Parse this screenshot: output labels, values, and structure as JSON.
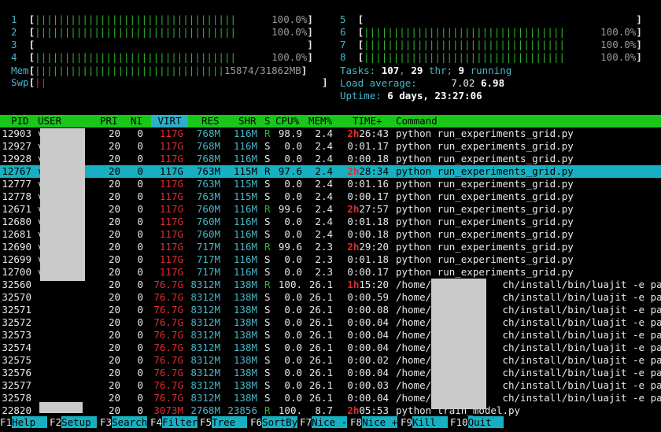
{
  "cpu_meters": [
    {
      "id": "1",
      "bar": "||||||||||||||||||||||||||||||||||",
      "value": "100.0%",
      "color": "g"
    },
    {
      "id": "2",
      "bar": "||||||||||||||||||||||||||||||||||",
      "value": "100.0%",
      "color": "g"
    },
    {
      "id": "3",
      "bar": "",
      "value": "",
      "color": "g"
    },
    {
      "id": "4",
      "bar": "||||||||||||||||||||||||||||||||||",
      "value": "100.0%",
      "color": "g"
    },
    {
      "id": "5",
      "bar": "",
      "value": "",
      "color": "g"
    },
    {
      "id": "6",
      "bar": "||||||||||||||||||||||||||||||||||",
      "value": "100.0%",
      "color": "g"
    },
    {
      "id": "7",
      "bar": "||||||||||||||||||||||||||||||||||",
      "value": "100.0%",
      "color": "g"
    },
    {
      "id": "8",
      "bar": "||||||||||||||||||||||||||||||||||",
      "value": "100.0%",
      "color": "g"
    }
  ],
  "mem": {
    "label": "Mem",
    "bar": "||||||||||||||||||||||||||||||||",
    "value": "15874/31862MB"
  },
  "swp": {
    "label": "Swp",
    "bar": "||",
    "value": ""
  },
  "tasks": {
    "label": "Tasks: ",
    "count": "107",
    "sep1": ", ",
    "threads": "29",
    "thr_label": " thr; ",
    "running": "9",
    "run_label": " running"
  },
  "load": {
    "label": "Load average: ",
    "v1": "7.02",
    "v2": "6.98"
  },
  "uptime": {
    "label": "Uptime: ",
    "value": "6 days, 23:27:06"
  },
  "columns": {
    "pid": "PID",
    "user": "USER",
    "pri": "PRI",
    "ni": "NI",
    "virt": "VIRT",
    "res": "RES",
    "shr": "SHR",
    "s": "S",
    "cpu": "CPU%",
    "mem": "MEM%",
    "time": "TIME+",
    "command": "Command"
  },
  "processes": [
    {
      "pid": "12903",
      "user": "v",
      "pri": "20",
      "ni": "0",
      "virt": "117G",
      "res": "768M",
      "shr": "116M",
      "s": "R",
      "cpu": "98.9",
      "mem": "2.4",
      "time_h": "2h",
      "time": "26:43",
      "cmd": "python run_experiments_grid.py"
    },
    {
      "pid": "12927",
      "user": "v",
      "pri": "20",
      "ni": "0",
      "virt": "117G",
      "res": "768M",
      "shr": "116M",
      "s": "S",
      "cpu": "0.0",
      "mem": "2.4",
      "time_h": "",
      "time": "0:01.17",
      "cmd": "python run_experiments_grid.py"
    },
    {
      "pid": "12928",
      "user": "v",
      "pri": "20",
      "ni": "0",
      "virt": "117G",
      "res": "768M",
      "shr": "116M",
      "s": "S",
      "cpu": "0.0",
      "mem": "2.4",
      "time_h": "",
      "time": "0:00.18",
      "cmd": "python run_experiments_grid.py"
    },
    {
      "pid": "12767",
      "user": "v",
      "pri": "20",
      "ni": "0",
      "virt": "117G",
      "res": "763M",
      "shr": "115M",
      "s": "R",
      "cpu": "97.6",
      "mem": "2.4",
      "time_h": "2h",
      "time": "28:34",
      "cmd": "python run_experiments_grid.py",
      "selected": true
    },
    {
      "pid": "12777",
      "user": "v",
      "pri": "20",
      "ni": "0",
      "virt": "117G",
      "res": "763M",
      "shr": "115M",
      "s": "S",
      "cpu": "0.0",
      "mem": "2.4",
      "time_h": "",
      "time": "0:01.16",
      "cmd": "python run_experiments_grid.py"
    },
    {
      "pid": "12778",
      "user": "v",
      "pri": "20",
      "ni": "0",
      "virt": "117G",
      "res": "763M",
      "shr": "115M",
      "s": "S",
      "cpu": "0.0",
      "mem": "2.4",
      "time_h": "",
      "time": "0:00.17",
      "cmd": "python run_experiments_grid.py"
    },
    {
      "pid": "12671",
      "user": "v",
      "pri": "20",
      "ni": "0",
      "virt": "117G",
      "res": "760M",
      "shr": "116M",
      "s": "R",
      "cpu": "99.6",
      "mem": "2.4",
      "time_h": "2h",
      "time": "27:57",
      "cmd": "python run_experiments_grid.py"
    },
    {
      "pid": "12680",
      "user": "v",
      "pri": "20",
      "ni": "0",
      "virt": "117G",
      "res": "760M",
      "shr": "116M",
      "s": "S",
      "cpu": "0.0",
      "mem": "2.4",
      "time_h": "",
      "time": "0:01.18",
      "cmd": "python run_experiments_grid.py"
    },
    {
      "pid": "12681",
      "user": "v",
      "pri": "20",
      "ni": "0",
      "virt": "117G",
      "res": "760M",
      "shr": "116M",
      "s": "S",
      "cpu": "0.0",
      "mem": "2.4",
      "time_h": "",
      "time": "0:00.18",
      "cmd": "python run_experiments_grid.py"
    },
    {
      "pid": "12690",
      "user": "v",
      "pri": "20",
      "ni": "0",
      "virt": "117G",
      "res": "717M",
      "shr": "116M",
      "s": "R",
      "cpu": "99.6",
      "mem": "2.3",
      "time_h": "2h",
      "time": "29:20",
      "cmd": "python run_experiments_grid.py"
    },
    {
      "pid": "12699",
      "user": "v",
      "pri": "20",
      "ni": "0",
      "virt": "117G",
      "res": "717M",
      "shr": "116M",
      "s": "S",
      "cpu": "0.0",
      "mem": "2.3",
      "time_h": "",
      "time": "0:01.18",
      "cmd": "python run_experiments_grid.py"
    },
    {
      "pid": "12700",
      "user": "v",
      "pri": "20",
      "ni": "0",
      "virt": "117G",
      "res": "717M",
      "shr": "116M",
      "s": "S",
      "cpu": "0.0",
      "mem": "2.3",
      "time_h": "",
      "time": "0:00.17",
      "cmd": "python run_experiments_grid.py"
    },
    {
      "pid": "32560",
      "user": "",
      "pri": "20",
      "ni": "0",
      "virt": "76.7G",
      "res": "8312M",
      "shr": "138M",
      "s": "R",
      "cpu": "100.",
      "mem": "26.1",
      "time_h": "1h",
      "time": "15:20",
      "cmd": "/home/            ch/install/bin/luajit -e pa"
    },
    {
      "pid": "32570",
      "user": "",
      "pri": "20",
      "ni": "0",
      "virt": "76.7G",
      "res": "8312M",
      "shr": "138M",
      "s": "S",
      "cpu": "0.0",
      "mem": "26.1",
      "time_h": "",
      "time": "0:00.59",
      "cmd": "/home/            ch/install/bin/luajit -e pa"
    },
    {
      "pid": "32571",
      "user": "",
      "pri": "20",
      "ni": "0",
      "virt": "76.7G",
      "res": "8312M",
      "shr": "138M",
      "s": "S",
      "cpu": "0.0",
      "mem": "26.1",
      "time_h": "",
      "time": "0:00.08",
      "cmd": "/home/            ch/install/bin/luajit -e pa"
    },
    {
      "pid": "32572",
      "user": "",
      "pri": "20",
      "ni": "0",
      "virt": "76.7G",
      "res": "8312M",
      "shr": "138M",
      "s": "S",
      "cpu": "0.0",
      "mem": "26.1",
      "time_h": "",
      "time": "0:00.04",
      "cmd": "/home/            ch/install/bin/luajit -e pa"
    },
    {
      "pid": "32573",
      "user": "",
      "pri": "20",
      "ni": "0",
      "virt": "76.7G",
      "res": "8312M",
      "shr": "138M",
      "s": "S",
      "cpu": "0.0",
      "mem": "26.1",
      "time_h": "",
      "time": "0:00.04",
      "cmd": "/home/            ch/install/bin/luajit -e pa"
    },
    {
      "pid": "32574",
      "user": "",
      "pri": "20",
      "ni": "0",
      "virt": "76.7G",
      "res": "8312M",
      "shr": "138M",
      "s": "S",
      "cpu": "0.0",
      "mem": "26.1",
      "time_h": "",
      "time": "0:00.04",
      "cmd": "/home/            ch/install/bin/luajit -e pa"
    },
    {
      "pid": "32575",
      "user": "",
      "pri": "20",
      "ni": "0",
      "virt": "76.7G",
      "res": "8312M",
      "shr": "138M",
      "s": "S",
      "cpu": "0.0",
      "mem": "26.1",
      "time_h": "",
      "time": "0:00.02",
      "cmd": "/home/            ch/install/bin/luajit -e pa"
    },
    {
      "pid": "32576",
      "user": "",
      "pri": "20",
      "ni": "0",
      "virt": "76.7G",
      "res": "8312M",
      "shr": "138M",
      "s": "S",
      "cpu": "0.0",
      "mem": "26.1",
      "time_h": "",
      "time": "0:00.04",
      "cmd": "/home/            ch/install/bin/luajit -e pa"
    },
    {
      "pid": "32577",
      "user": "",
      "pri": "20",
      "ni": "0",
      "virt": "76.7G",
      "res": "8312M",
      "shr": "138M",
      "s": "S",
      "cpu": "0.0",
      "mem": "26.1",
      "time_h": "",
      "time": "0:00.03",
      "cmd": "/home/            ch/install/bin/luajit -e pa"
    },
    {
      "pid": "32578",
      "user": "",
      "pri": "20",
      "ni": "0",
      "virt": "76.7G",
      "res": "8312M",
      "shr": "138M",
      "s": "S",
      "cpu": "0.0",
      "mem": "26.1",
      "time_h": "",
      "time": "0:00.04",
      "cmd": "/home/            ch/install/bin/luajit -e pa"
    },
    {
      "pid": "22820",
      "user": "",
      "pri": "20",
      "ni": "0",
      "virt": "3073M",
      "res": "2768M",
      "shr": "23856",
      "s": "R",
      "cpu": "100.",
      "mem": "8.7",
      "time_h": "2h",
      "time": "05:53",
      "cmd": "python train_model.py"
    }
  ],
  "fkeys": [
    {
      "key": "F1",
      "label": "Help  "
    },
    {
      "key": "F2",
      "label": "Setup "
    },
    {
      "key": "F3",
      "label": "Search"
    },
    {
      "key": "F4",
      "label": "Filter"
    },
    {
      "key": "F5",
      "label": "Tree  "
    },
    {
      "key": "F6",
      "label": "SortBy"
    },
    {
      "key": "F7",
      "label": "Nice -"
    },
    {
      "key": "F8",
      "label": "Nice +"
    },
    {
      "key": "F9",
      "label": "Kill  "
    },
    {
      "key": "F10",
      "label": "Quit  "
    }
  ]
}
